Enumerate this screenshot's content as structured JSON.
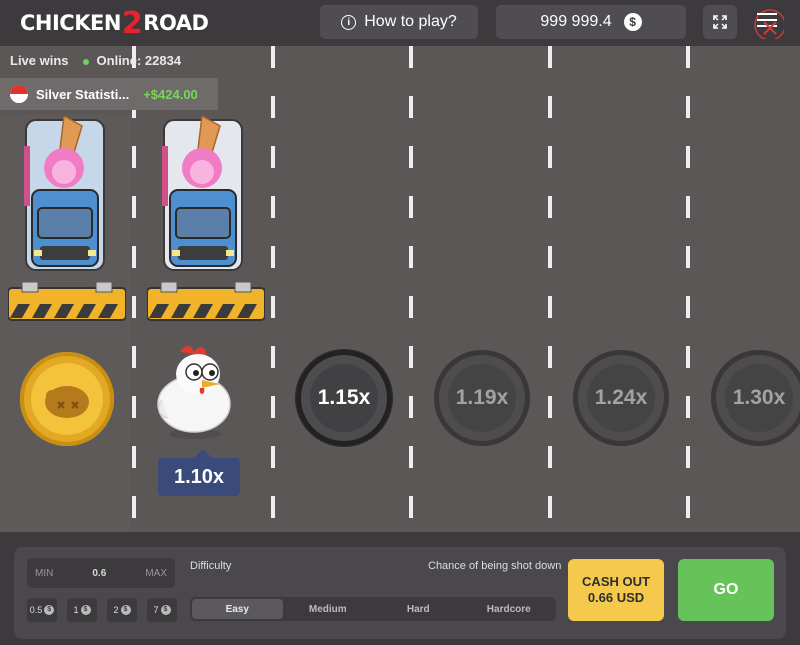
{
  "header": {
    "logo_left": "CHICKEN",
    "logo_num": "2",
    "logo_right": "ROAD",
    "how_to_play_label": "How to play?",
    "balance": "999 999.4",
    "currency_symbol": "$"
  },
  "live": {
    "live_wins_label": "Live wins",
    "online_label": "Online: 22834",
    "recent_win_user": "Silver Statisti...",
    "recent_win_amount": "+$424.00"
  },
  "game": {
    "current_multiplier": "1.10x",
    "lanes": [
      {
        "multiplier": "1.15x",
        "state": "next"
      },
      {
        "multiplier": "1.19x",
        "state": "locked"
      },
      {
        "multiplier": "1.24x",
        "state": "locked"
      },
      {
        "multiplier": "1.30x",
        "state": "locked"
      }
    ]
  },
  "controls": {
    "min_label": "MIN",
    "bet_value": "0.6",
    "max_label": "MAX",
    "chips": [
      "0.5",
      "1",
      "2",
      "7"
    ],
    "difficulty_label": "Difficulty",
    "chance_label": "Chance of being shot down",
    "difficulties": [
      "Easy",
      "Medium",
      "Hard",
      "Hardcore"
    ],
    "selected_difficulty": "Easy",
    "cashout_label": "CASH OUT",
    "cashout_amount": "0.66 USD",
    "go_label": "GO"
  },
  "colors": {
    "accent_yellow": "#f5c94b",
    "accent_green": "#65c35a",
    "win_green": "#78d65a"
  }
}
